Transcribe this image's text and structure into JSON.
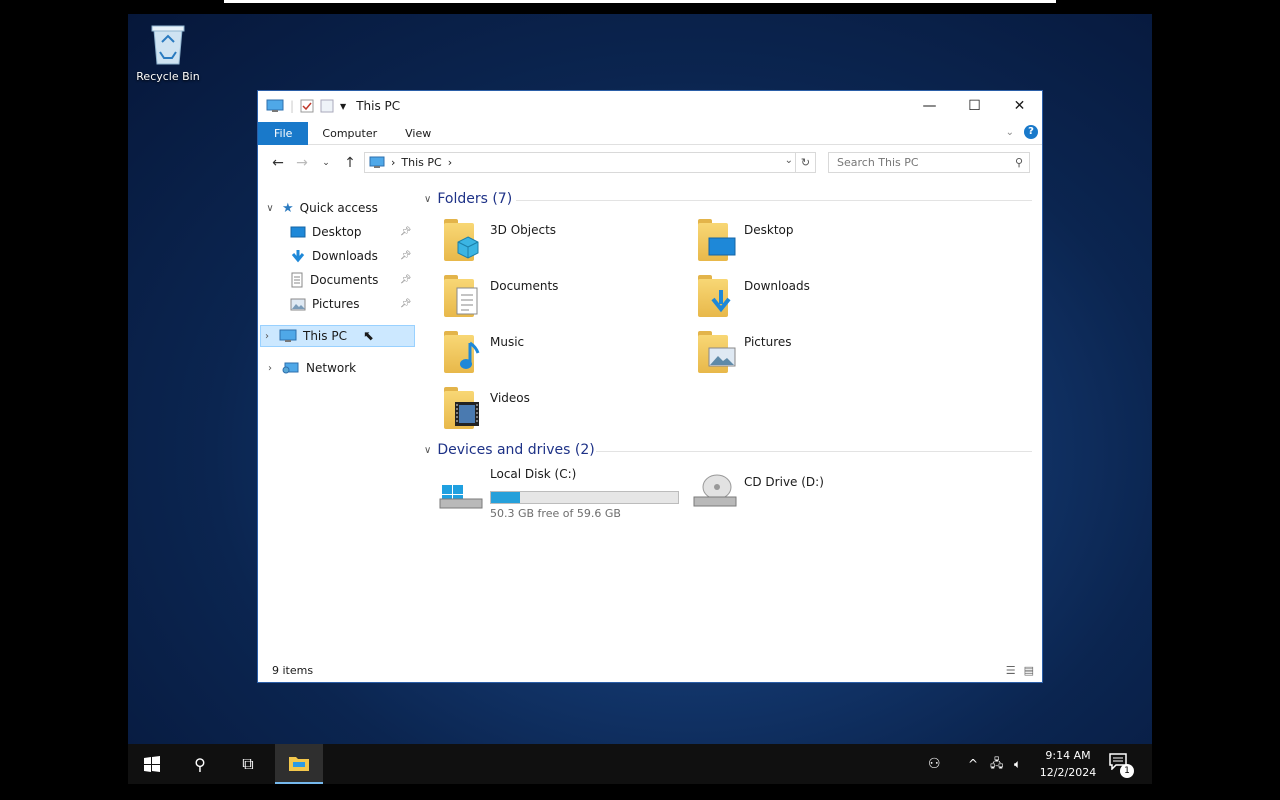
{
  "desktop": {
    "icons": [
      {
        "label": "Recycle Bin",
        "icon": "recycle-bin-icon"
      }
    ]
  },
  "window": {
    "title": "This PC",
    "ribbon_tabs": [
      "File",
      "Computer",
      "View"
    ],
    "address": {
      "path": [
        "This PC"
      ]
    },
    "search": {
      "placeholder": "Search This PC"
    },
    "sidebar": {
      "quick_access": {
        "label": "Quick access",
        "items": [
          {
            "label": "Desktop",
            "icon": "desktop-icon",
            "pinned": true
          },
          {
            "label": "Downloads",
            "icon": "download-icon",
            "pinned": true
          },
          {
            "label": "Documents",
            "icon": "document-icon",
            "pinned": true
          },
          {
            "label": "Pictures",
            "icon": "picture-icon",
            "pinned": true
          }
        ]
      },
      "this_pc": {
        "label": "This PC",
        "selected": true
      },
      "network": {
        "label": "Network"
      }
    },
    "folders_group": {
      "title": "Folders (7)",
      "items": [
        {
          "name": "3D Objects"
        },
        {
          "name": "Desktop"
        },
        {
          "name": "Documents"
        },
        {
          "name": "Downloads"
        },
        {
          "name": "Music"
        },
        {
          "name": "Pictures"
        },
        {
          "name": "Videos"
        }
      ]
    },
    "drives_group": {
      "title": "Devices and drives (2)",
      "items": [
        {
          "name": "Local Disk (C:)",
          "free_text": "50.3 GB free of 59.6 GB",
          "used_fraction": 0.156
        },
        {
          "name": "CD Drive (D:)"
        }
      ]
    },
    "status": {
      "items": "9 items"
    }
  },
  "taskbar": {
    "time": "9:14 AM",
    "date": "12/2/2024",
    "notification_count": "1"
  },
  "colors": {
    "accent": "#1979ca",
    "selection": "#cce8ff",
    "progress": "#26a0da",
    "taskbar": "#101010"
  }
}
